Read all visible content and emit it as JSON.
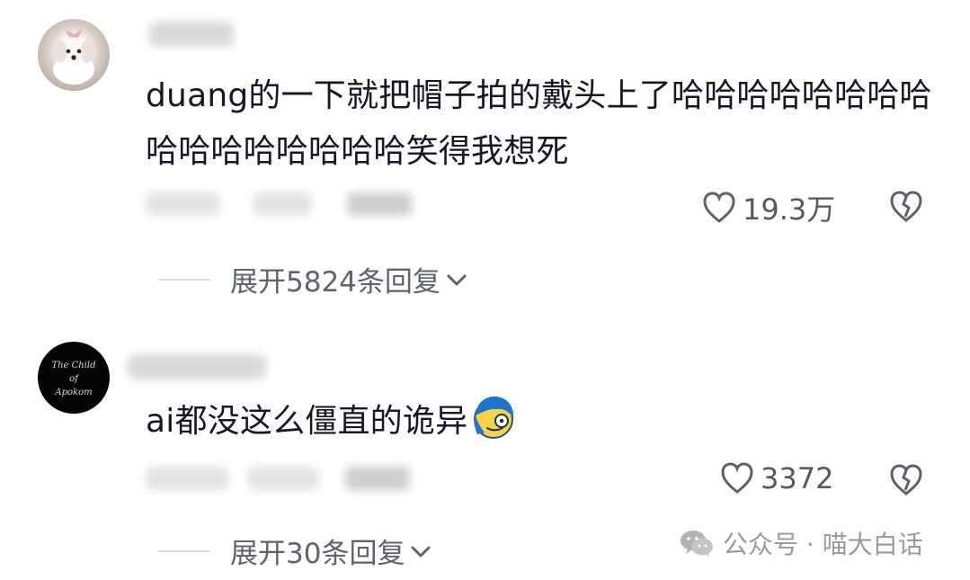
{
  "comments": [
    {
      "text": "duang的一下就把帽子拍的戴头上了哈哈哈哈哈哈哈哈哈哈哈哈哈哈哈哈笑得我想死",
      "likes": "19.3万",
      "expand_label": "展开5824条回复",
      "avatar_icon": "dog-avatar"
    },
    {
      "text": "ai都没这么僵直的诡异",
      "likes": "3372",
      "expand_label": "展开30条回复",
      "avatar_lines": [
        "The Child",
        "of",
        "Apokom"
      ],
      "emoji_icon": "blue-hair-character-emoji"
    }
  ],
  "watermark": {
    "text": "公众号 · 喵大白话",
    "icon": "wechat-icon"
  },
  "colors": {
    "text": "#161823",
    "meta": "#555a61",
    "watermark": "#9a9a9a"
  }
}
